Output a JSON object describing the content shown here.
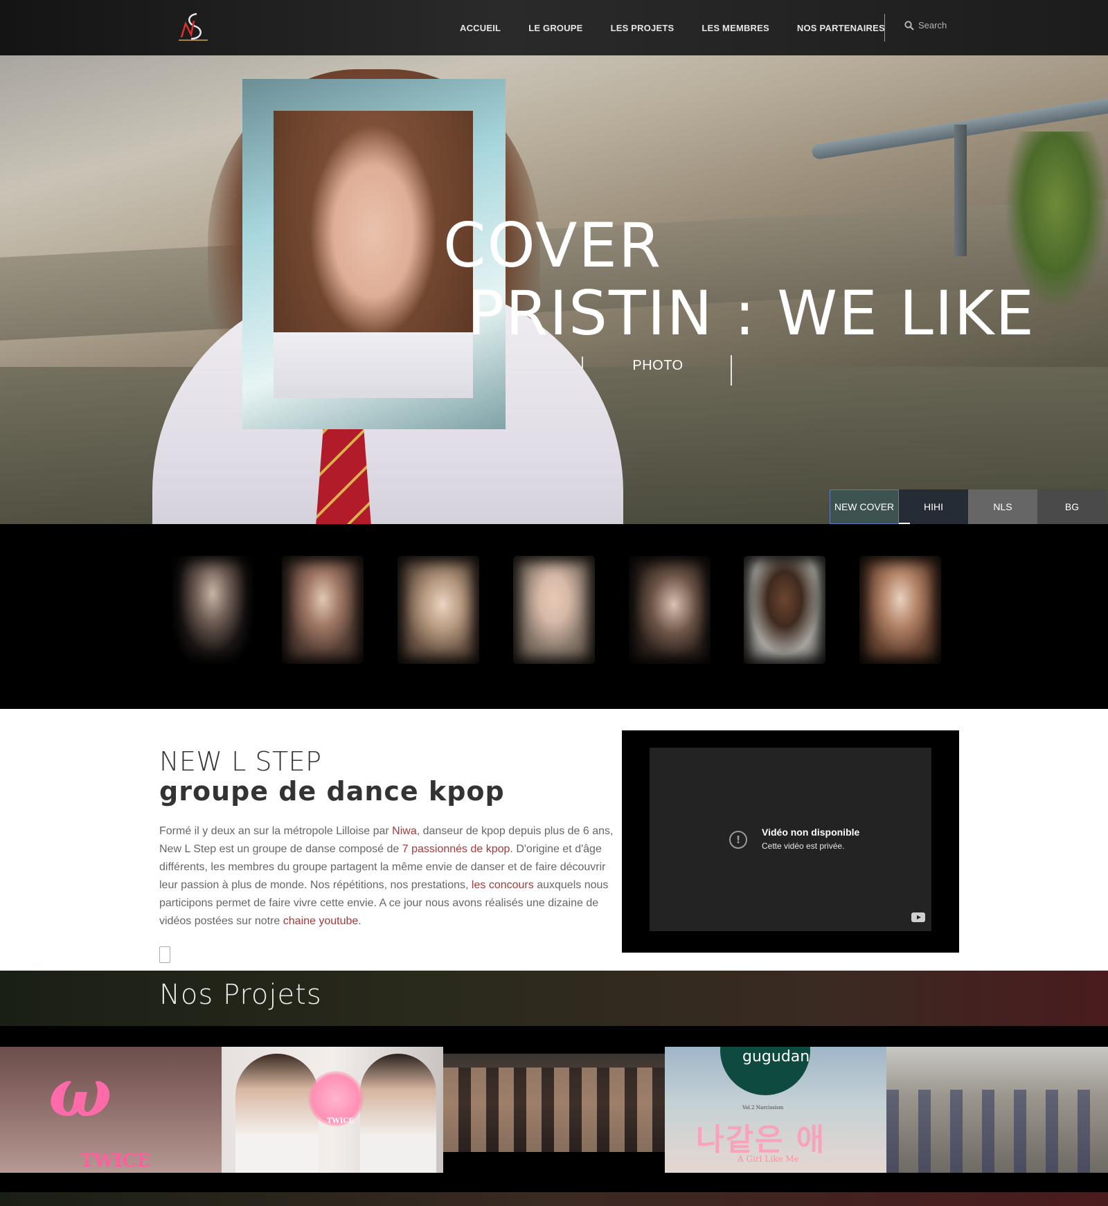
{
  "nav": {
    "items": [
      "ACCUEIL",
      "LE GROUPE",
      "LES PROJETS",
      "LES MEMBRES",
      "NOS PARTENAIRES"
    ],
    "search_placeholder": "Search"
  },
  "hero": {
    "title_line1": "COVER",
    "title_line2": "PRISTIN : WE LIKE",
    "category": "PHOTO",
    "tabs": [
      "NEW COVER",
      "HIHI",
      "NLS",
      "BG"
    ],
    "active_tab": "NEW COVER"
  },
  "about": {
    "title": "NEW L STEP",
    "subtitle": "groupe de dance kpop",
    "paragraph": [
      {
        "t": "Formé il y deux an sur la métropole Lilloise par ",
        "hl": false
      },
      {
        "t": "Niwa",
        "hl": true
      },
      {
        "t": ", danseur de kpop depuis plus de 6 ans, New L Step est un groupe de danse composé de ",
        "hl": false
      },
      {
        "t": "7 passionnés de kpop",
        "hl": true
      },
      {
        "t": ". D'origine et d'âge différents, les membres du groupe partagent la même envie de danser et de faire découvrir leur passion à plus de monde. Nos répétitions, nos prestations, ",
        "hl": false
      },
      {
        "t": "les concours",
        "hl": true
      },
      {
        "t": " auxquels nous participons permet de faire vivre cette envie. A ce jour nous avons réalisés une dizaine de vidéos postées sur notre ",
        "hl": false
      },
      {
        "t": "chaine youtube",
        "hl": true
      },
      {
        "t": ".",
        "hl": false
      }
    ],
    "video": {
      "title": "Vidéo non disponible",
      "subtitle": "Cette vidéo est privée.",
      "icon": "alert-circle-icon"
    }
  },
  "projects": {
    "title": "Nos Projets",
    "thumb_texts": {
      "twice_1": "TWICE",
      "twice_2": "TWICE",
      "gugudan": "gugudan",
      "gugudan_kr": "나같은 애",
      "gugudan_en": "A Girl Like Me",
      "gugudan_small": "Vol.2 Narcissism"
    }
  },
  "colors": {
    "accent_link": "#a33a3a",
    "active_tab": "#3c5350",
    "nav_bg": "#1f1f1f"
  }
}
